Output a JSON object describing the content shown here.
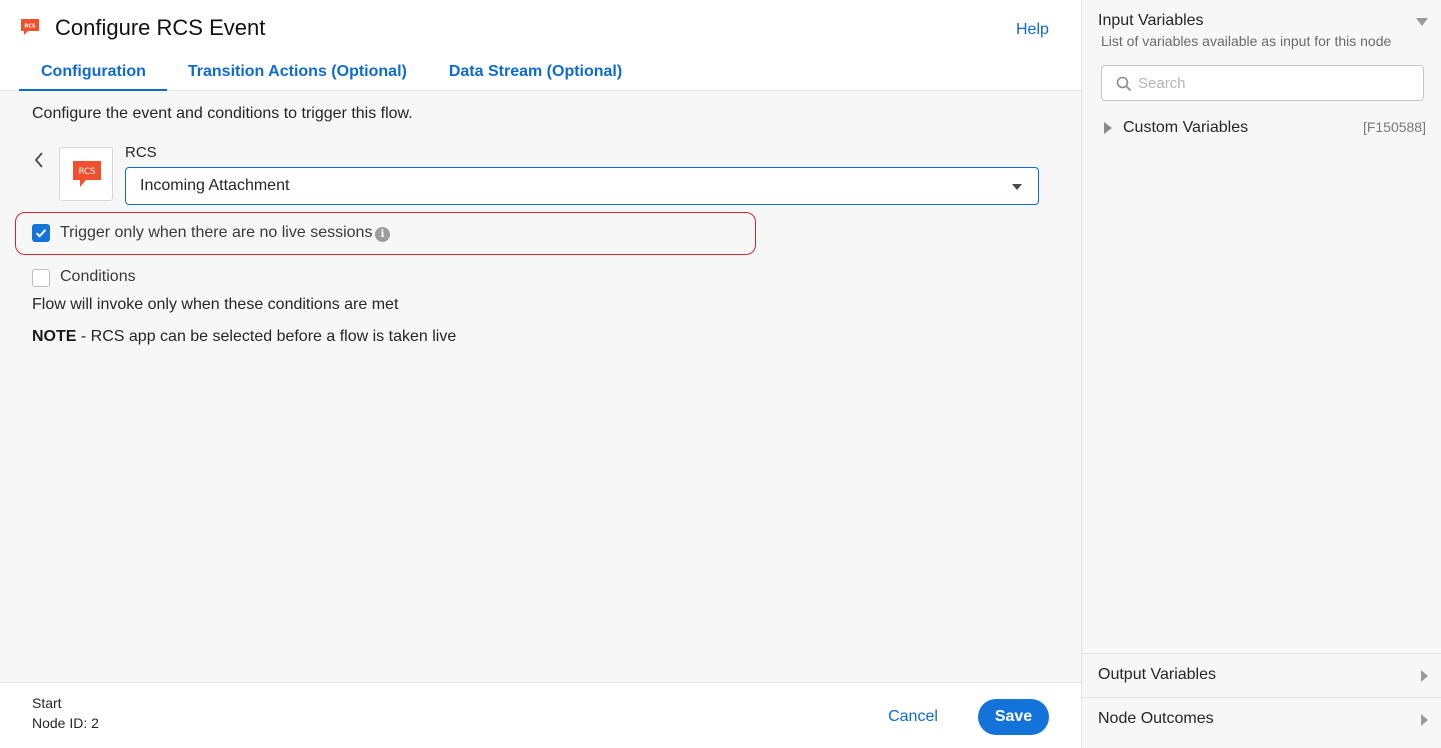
{
  "header": {
    "title": "Configure RCS Event",
    "help_label": "Help",
    "app_icon_text": "RCS"
  },
  "tabs": [
    {
      "label": "Configuration",
      "active": true
    },
    {
      "label": "Transition Actions (Optional)",
      "active": false
    },
    {
      "label": "Data Stream (Optional)",
      "active": false
    }
  ],
  "configuration": {
    "intro": "Configure the event and conditions to trigger this flow.",
    "app_label": "RCS",
    "app_tile_text": "RCS",
    "event_select": {
      "value": "Incoming Attachment"
    },
    "trigger_checkbox": {
      "label": "Trigger only when there are no live sessions",
      "checked": true
    },
    "info_glyph": "i",
    "conditions_checkbox": {
      "label": "Conditions",
      "checked": false
    },
    "conditions_note": "Flow will invoke only when these conditions are met",
    "note_prefix": "NOTE",
    "note_text": " - RCS app can be selected before a flow is taken live"
  },
  "footer": {
    "node_name": "Start",
    "node_id": "Node ID: 2",
    "cancel_label": "Cancel",
    "save_label": "Save"
  },
  "side_panel": {
    "title": "Input Variables",
    "subtitle": "List of variables available as input for this node",
    "search_placeholder": "Search",
    "tree": [
      {
        "label": "Custom Variables",
        "code": "[F150588]"
      }
    ],
    "output_label": "Output Variables",
    "outcomes_label": "Node Outcomes"
  },
  "colors": {
    "accent": "#1473d9",
    "link": "#0d6bd4",
    "highlight": "#d6262b",
    "rcs_brand": "#f0502d"
  },
  "icons": [
    "rcs-chat-icon",
    "chevron-left-icon",
    "check-icon",
    "info-icon",
    "search-icon",
    "caret-right-icon",
    "caret-down-icon"
  ]
}
